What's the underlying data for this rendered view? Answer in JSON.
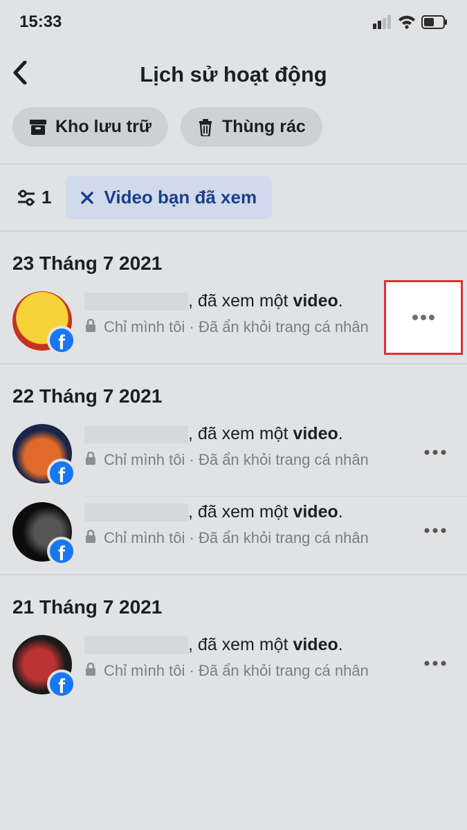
{
  "status": {
    "time": "15:33"
  },
  "header": {
    "title": "Lịch sử hoạt động"
  },
  "actions": {
    "archive": "Kho lưu trữ",
    "trash": "Thùng rác"
  },
  "filters": {
    "count": "1",
    "chip": "Video bạn đã xem"
  },
  "sections": [
    {
      "date": "23 Tháng 7 2021",
      "items": [
        {
          "action_pre": ", đã xem một ",
          "action_bold": "video",
          "action_post": ".",
          "privacy": "Chỉ mình tôi",
          "meta_sep": " · ",
          "meta_rest": "Đã ẩn khỏi trang cá nhân"
        }
      ]
    },
    {
      "date": "22 Tháng 7 2021",
      "items": [
        {
          "action_pre": ", đã xem một ",
          "action_bold": "video",
          "action_post": ".",
          "privacy": "Chỉ mình tôi",
          "meta_sep": " · ",
          "meta_rest": "Đã ẩn khỏi trang cá nhân"
        },
        {
          "action_pre": ", đã xem một ",
          "action_bold": "video",
          "action_post": ".",
          "privacy": "Chỉ mình tôi",
          "meta_sep": " · ",
          "meta_rest": "Đã ẩn khỏi trang cá nhân"
        }
      ]
    },
    {
      "date": "21 Tháng 7 2021",
      "items": [
        {
          "action_pre": ", đã xem một ",
          "action_bold": "video",
          "action_post": ".",
          "privacy": "Chỉ mình tôi",
          "meta_sep": " · ",
          "meta_rest": "Đã ẩn khỏi trang cá nhân"
        }
      ]
    }
  ]
}
